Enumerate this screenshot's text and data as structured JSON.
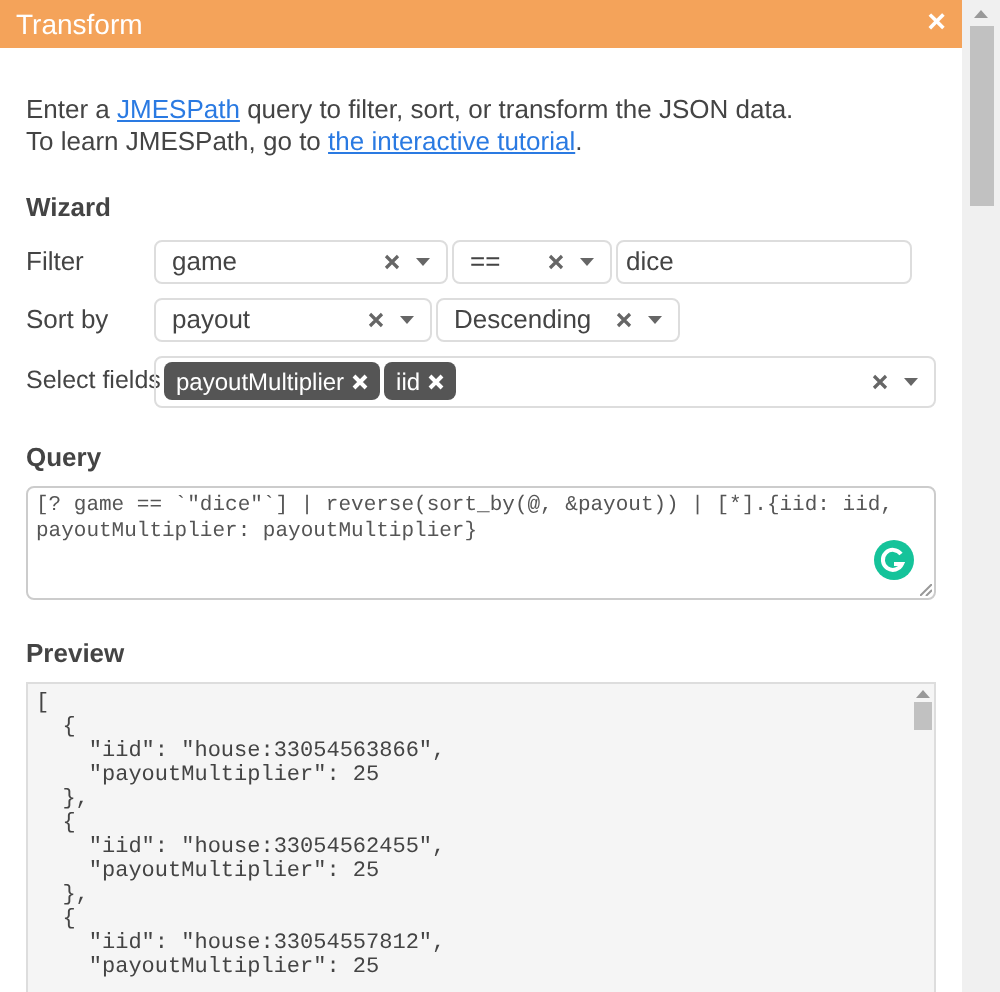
{
  "dialog": {
    "title": "Transform",
    "close": "×"
  },
  "intro": {
    "line1_before": "Enter a ",
    "line1_link": "JMESPath",
    "line1_after": " query to filter, sort, or transform the JSON data.",
    "line2_before": "To learn JMESPath, go to ",
    "line2_link": "the interactive tutorial",
    "line2_after": "."
  },
  "wizard": {
    "heading": "Wizard",
    "filter": {
      "label": "Filter",
      "field": "game",
      "operator": "==",
      "value": "dice"
    },
    "sort": {
      "label": "Sort by",
      "field": "payout",
      "order": "Descending"
    },
    "select": {
      "label": "Select fields",
      "tags": [
        "payoutMultiplier",
        "iid"
      ]
    }
  },
  "query": {
    "heading": "Query",
    "text": "[? game == `\"dice\"`] | reverse(sort_by(@, &payout)) | [*].{iid: iid, payoutMultiplier: payoutMultiplier}"
  },
  "preview": {
    "heading": "Preview",
    "lines": [
      "[",
      "  {",
      "    \"iid\": \"house:33054563866\",",
      "    \"payoutMultiplier\": 25",
      "  },",
      "  {",
      "    \"iid\": \"house:33054562455\",",
      "    \"payoutMultiplier\": 25",
      "  },",
      "  {",
      "    \"iid\": \"house:33054557812\",",
      "    \"payoutMultiplier\": 25"
    ]
  }
}
